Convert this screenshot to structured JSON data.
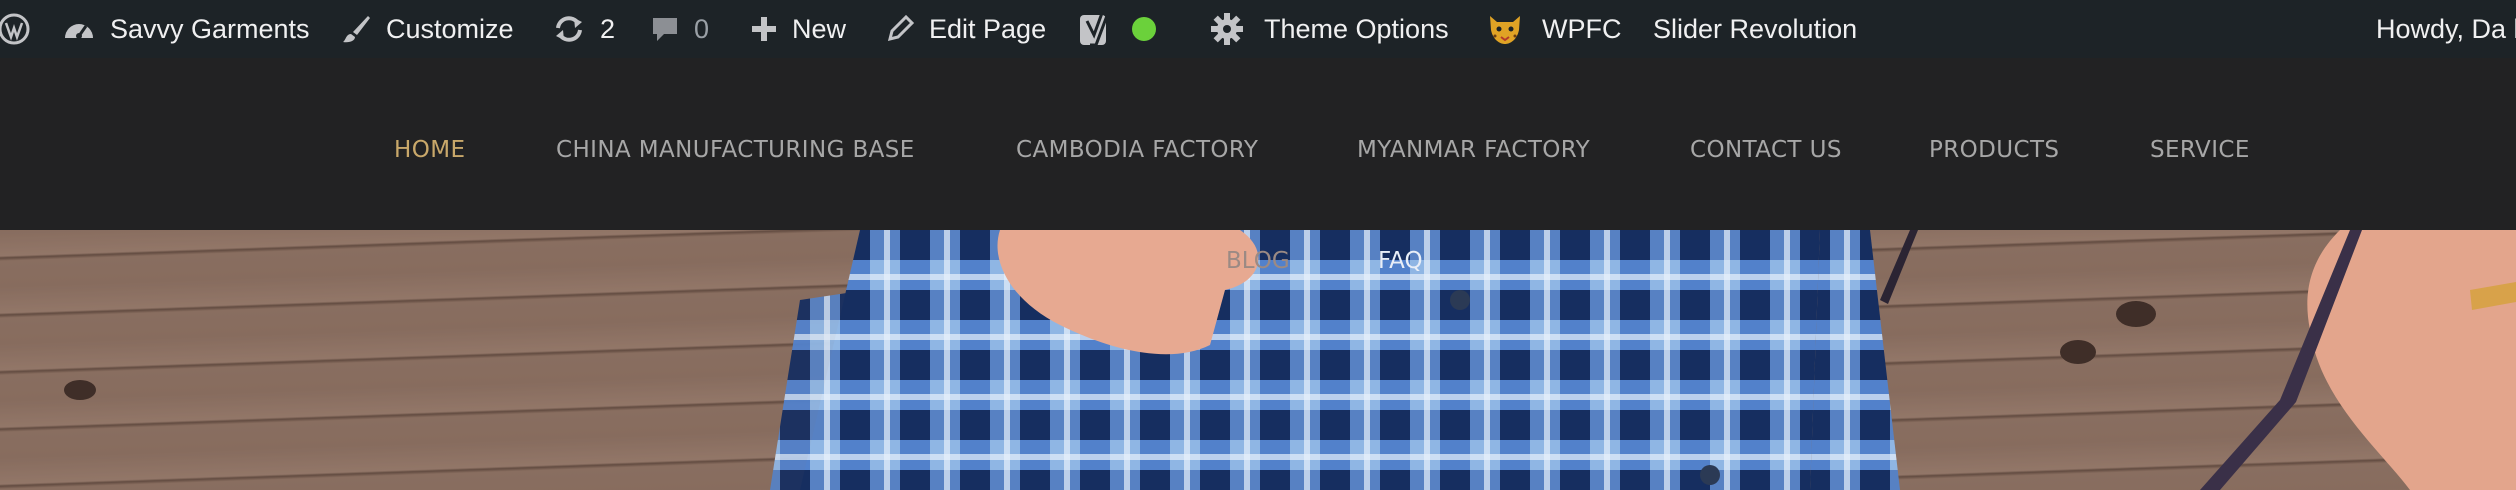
{
  "admin_bar": {
    "site_name": "Savvy Garments",
    "customize": "Customize",
    "updates_count": "2",
    "comments_count": "0",
    "new": "New",
    "edit_page": "Edit Page",
    "theme_options": "Theme Options",
    "wpfc": "WPFC",
    "slider_revolution": "Slider Revolution",
    "howdy": "Howdy, Da l",
    "seo_status_color": "#6bd13b"
  },
  "nav": {
    "items": [
      {
        "label": "HOME",
        "active": true
      },
      {
        "label": "CHINA MANUFACTURING BASE"
      },
      {
        "label": "CAMBODIA FACTORY"
      },
      {
        "label": "MYANMAR FACTORY"
      },
      {
        "label": "CONTACT US"
      },
      {
        "label": "PRODUCTS"
      },
      {
        "label": "SERVICE"
      }
    ],
    "second_row": [
      {
        "label": "BLOG"
      },
      {
        "label": "FAQ"
      }
    ],
    "active_color": "#c9a86a",
    "text_color": "#a7a7a7"
  }
}
